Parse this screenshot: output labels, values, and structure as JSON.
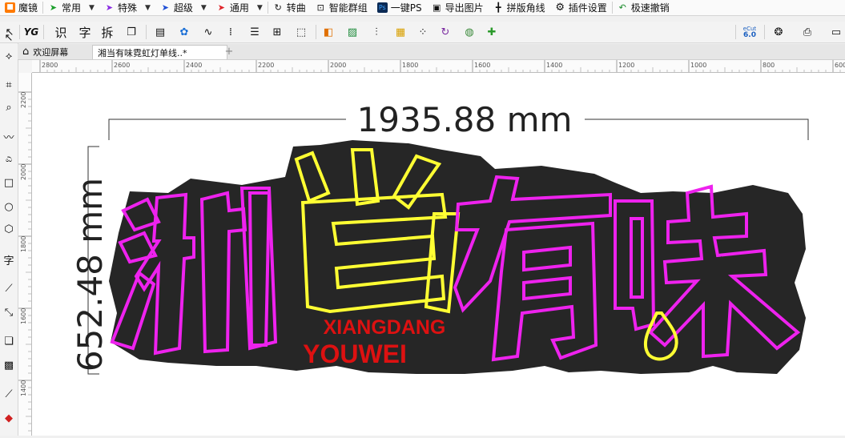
{
  "menubar": {
    "items": [
      {
        "icon": "mirror-icon",
        "label": "魔镜",
        "caret": false
      },
      {
        "icon": "arrow-green-icon",
        "label": "常用",
        "caret": true
      },
      {
        "icon": "arrow-purple-icon",
        "label": "特殊",
        "caret": true
      },
      {
        "icon": "arrow-blue-icon",
        "label": "超级",
        "caret": true
      },
      {
        "icon": "arrow-red-icon",
        "label": "通用",
        "caret": true
      },
      {
        "icon": "convert-icon",
        "label": "转曲",
        "caret": false
      },
      {
        "icon": "smart-group-icon",
        "label": "智能群组",
        "caret": false
      },
      {
        "icon": "photoshop-icon",
        "label": "一键PS",
        "caret": false
      },
      {
        "icon": "image-export-icon",
        "label": "导出图片",
        "caret": false
      },
      {
        "icon": "crop-marks-icon",
        "label": "拼版角线",
        "caret": false
      },
      {
        "icon": "gear-icon",
        "label": "插件设置",
        "caret": false
      },
      {
        "icon": "undo-icon",
        "label": "极速撤销",
        "caret": false
      }
    ]
  },
  "toolbar": {
    "yg_label": "YG",
    "shi_label": "识",
    "zi_label": "字",
    "chai_label": "拆",
    "ecut_label": "eCut",
    "ecut_version": "6.0"
  },
  "toolbox": {
    "text_tool_label": "字"
  },
  "tabs": {
    "items": [
      {
        "label": "欢迎屏幕",
        "active": false
      },
      {
        "label": "湘当有味霓虹灯单线..*",
        "active": true
      }
    ],
    "add_label": "+"
  },
  "hruler": {
    "ticks": [
      "2800",
      "2600",
      "2400",
      "2200",
      "2000",
      "1800",
      "1600",
      "1400",
      "1200",
      "1000",
      "800",
      "600"
    ]
  },
  "vruler": {
    "ticks": [
      "2200",
      "2000",
      "1800",
      "1600",
      "1400"
    ]
  },
  "drawing": {
    "width_dimension": "1935.88 mm",
    "height_dimension": "652.48 mm",
    "char1": "湘",
    "char2": "当",
    "char3": "有",
    "char4": "味",
    "sub_line1": "XIANGDANG",
    "sub_line2": "YOUWEI",
    "colors": {
      "magenta": "#ee22ee",
      "yellow": "#ffff33",
      "red": "#dd1111",
      "fill": "#262626"
    }
  }
}
